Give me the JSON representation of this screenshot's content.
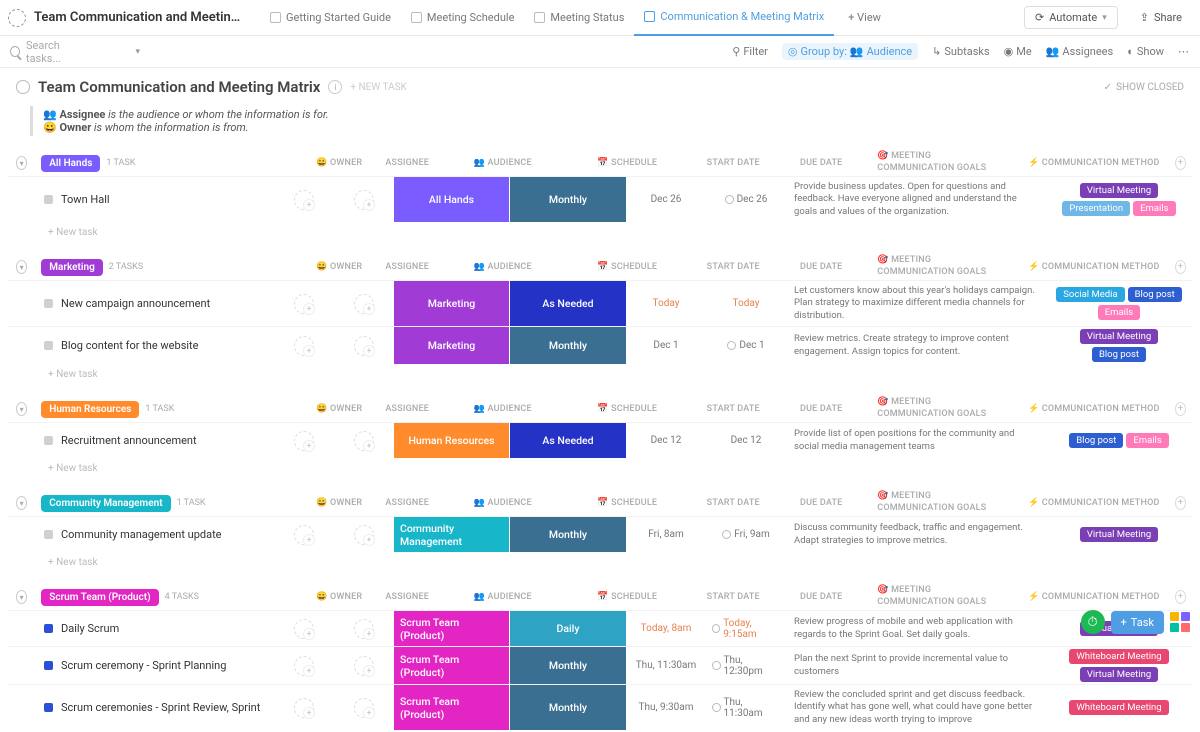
{
  "workspace_title": "Team Communication and Meeting Ma...",
  "tabs": [
    {
      "label": "Getting Started Guide",
      "active": false
    },
    {
      "label": "Meeting Schedule",
      "active": false
    },
    {
      "label": "Meeting Status",
      "active": false
    },
    {
      "label": "Communication & Meeting Matrix",
      "active": true
    }
  ],
  "add_view": "+ View",
  "automate": "Automate",
  "share": "Share",
  "search_placeholder": "Search tasks...",
  "toolbar": {
    "filter": "Filter",
    "group_by": "Group by:",
    "group_by_value": "Audience",
    "subtasks": "Subtasks",
    "me": "Me",
    "assignees": "Assignees",
    "show": "Show"
  },
  "page_title": "Team Communication and Meeting Matrix",
  "new_task": "+ NEW TASK",
  "show_closed": "SHOW CLOSED",
  "notes": {
    "l1_label": "Assignee",
    "l1_text": " is the audience or whom the information is for.",
    "l2_label": "Owner",
    "l2_text": " is whom the information is from."
  },
  "columns": {
    "owner": "OWNER",
    "assignee": "ASSIGNEE",
    "audience": "AUDIENCE",
    "schedule": "SCHEDULE",
    "start": "START DATE",
    "due": "DUE DATE",
    "goals": "MEETING COMMUNICATION GOALS",
    "method": "COMMUNICATION METHOD"
  },
  "new_task_row": "+ New task",
  "colors": {
    "allhands": "#7b5cff",
    "marketing": "#a03bd6",
    "hr": "#ff8b2c",
    "community": "#17b6c9",
    "scrum": "#e225c3",
    "sched_monthly": "#3b6f91",
    "sched_asneeded": "#2432c6",
    "sched_daily": "#2fa3c4",
    "pill_virtual": "#7b3fb5",
    "pill_presentation": "#6fb7e6",
    "pill_emails": "#ff7ab8",
    "pill_social": "#2aa7e0",
    "pill_blog": "#2e5fd1",
    "pill_whiteboard": "#e8476f"
  },
  "groups": [
    {
      "name": "All Hands",
      "badge_bg": "#7b5cff",
      "count": "1 TASK",
      "tasks": [
        {
          "name": "Town Hall",
          "sq": "#d0d0d0",
          "audience": "All Hands",
          "aud_bg": "#7b5cff",
          "schedule": "Monthly",
          "sched_bg": "#3b6f91",
          "start": "Dec 26",
          "due": "Dec 26",
          "loop": true,
          "goals": "Provide business updates. Open for questions and feedback. Have everyone aligned and understand the goals and values of the organization.",
          "methods": [
            {
              "t": "Virtual Meeting",
              "c": "#7b3fb5"
            },
            {
              "t": "Presentation",
              "c": "#6fb7e6"
            },
            {
              "t": "Emails",
              "c": "#ff7ab8"
            }
          ]
        }
      ]
    },
    {
      "name": "Marketing",
      "badge_bg": "#a03bd6",
      "count": "2 TASKS",
      "tasks": [
        {
          "name": "New campaign announcement",
          "sq": "#d0d0d0",
          "audience": "Marketing",
          "aud_bg": "#a03bd6",
          "schedule": "As Needed",
          "sched_bg": "#2432c6",
          "start": "Today",
          "due": "Today",
          "today": true,
          "goals": "Let customers know about this year's holidays campaign. Plan strategy to maximize different media channels for distribution.",
          "methods": [
            {
              "t": "Social Media",
              "c": "#2aa7e0"
            },
            {
              "t": "Blog post",
              "c": "#2e5fd1"
            },
            {
              "t": "Emails",
              "c": "#ff7ab8"
            }
          ]
        },
        {
          "name": "Blog content for the website",
          "sq": "#d0d0d0",
          "audience": "Marketing",
          "aud_bg": "#a03bd6",
          "schedule": "Monthly",
          "sched_bg": "#3b6f91",
          "start": "Dec 1",
          "due": "Dec 1",
          "loop": true,
          "goals": "Review metrics. Create strategy to improve content engagement. Assign topics for content.",
          "methods": [
            {
              "t": "Virtual Meeting",
              "c": "#7b3fb5"
            },
            {
              "t": "Blog post",
              "c": "#2e5fd1"
            }
          ]
        }
      ]
    },
    {
      "name": "Human Resources",
      "badge_bg": "#ff8b2c",
      "count": "1 TASK",
      "tasks": [
        {
          "name": "Recruitment announcement",
          "sq": "#d0d0d0",
          "audience": "Human Resources",
          "aud_bg": "#ff8b2c",
          "schedule": "As Needed",
          "sched_bg": "#2432c6",
          "start": "Dec 12",
          "due": "Dec 12",
          "goals": "Provide list of open positions for the community and social media management teams",
          "methods": [
            {
              "t": "Blog post",
              "c": "#2e5fd1"
            },
            {
              "t": "Emails",
              "c": "#ff7ab8"
            }
          ]
        }
      ]
    },
    {
      "name": "Community Management",
      "badge_bg": "#17b6c9",
      "count": "1 TASK",
      "tasks": [
        {
          "name": "Community management update",
          "sq": "#d0d0d0",
          "audience": "Community Management",
          "aud_bg": "#17b6c9",
          "schedule": "Monthly",
          "sched_bg": "#3b6f91",
          "start": "Fri, 8am",
          "due": "Fri, 9am",
          "loop": true,
          "goals": "Discuss community feedback, traffic and engagement. Adapt strategies to improve metrics.",
          "methods": [
            {
              "t": "Virtual Meeting",
              "c": "#7b3fb5"
            }
          ]
        }
      ]
    },
    {
      "name": "Scrum Team (Product)",
      "badge_bg": "#e225c3",
      "count": "4 TASKS",
      "tasks": [
        {
          "name": "Daily Scrum",
          "sq": "#2b4fd8",
          "audience": "Scrum Team (Product)",
          "aud_bg": "#e225c3",
          "schedule": "Daily",
          "sched_bg": "#2fa3c4",
          "start": "Today, 8am",
          "due": "Today, 9:15am",
          "today": true,
          "loop": true,
          "goals": "Review progress of mobile and web application with regards to the Sprint Goal. Set daily goals.",
          "methods": [
            {
              "t": "Virtual Meeting",
              "c": "#7b3fb5"
            }
          ]
        },
        {
          "name": "Scrum ceremony - Sprint Planning",
          "sq": "#2b4fd8",
          "audience": "Scrum Team (Product)",
          "aud_bg": "#e225c3",
          "schedule": "Monthly",
          "sched_bg": "#3b6f91",
          "start": "Thu, 11:30am",
          "due": "Thu, 12:30pm",
          "loop": true,
          "goals": "Plan the next Sprint to provide incremental value to customers",
          "methods": [
            {
              "t": "Whiteboard Meeting",
              "c": "#e8476f"
            },
            {
              "t": "Virtual Meeting",
              "c": "#7b3fb5"
            }
          ]
        },
        {
          "name": "Scrum ceremonies - Sprint Review, Sprint",
          "sq": "#2b4fd8",
          "audience": "Scrum Team (Product)",
          "aud_bg": "#e225c3",
          "schedule": "Monthly",
          "sched_bg": "#3b6f91",
          "start": "Thu, 9:30am",
          "due": "Thu, 11:30am",
          "loop": true,
          "goals": "Review the concluded sprint and get discuss feedback. Identify what has gone well, what could have gone better and any new ideas worth trying to improve",
          "methods": [
            {
              "t": "Whiteboard Meeting",
              "c": "#e8476f"
            }
          ]
        }
      ]
    }
  ],
  "fab_task": "Task"
}
